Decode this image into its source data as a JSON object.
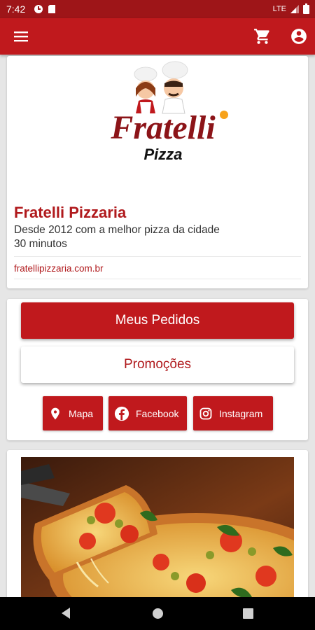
{
  "status_bar": {
    "time": "7:42",
    "network": "LTE"
  },
  "app_bar": {
    "menu_icon": "menu-icon",
    "cart_icon": "cart-icon",
    "account_icon": "account-icon"
  },
  "restaurant": {
    "logo_text": "Fratelli",
    "logo_subtext": "Pizza",
    "name": "Fratelli Pizzaria",
    "description": "Desde 2012 com a melhor pizza da cidade",
    "delivery_time": "30 minutos",
    "website": "fratellipizzaria.com.br"
  },
  "actions": {
    "orders_label": "Meus Pedidos",
    "promotions_label": "Promoções",
    "map_label": "Mapa",
    "facebook_label": "Facebook",
    "instagram_label": "Instagram"
  },
  "colors": {
    "primary": "#c0191d",
    "status": "#9e1518"
  }
}
